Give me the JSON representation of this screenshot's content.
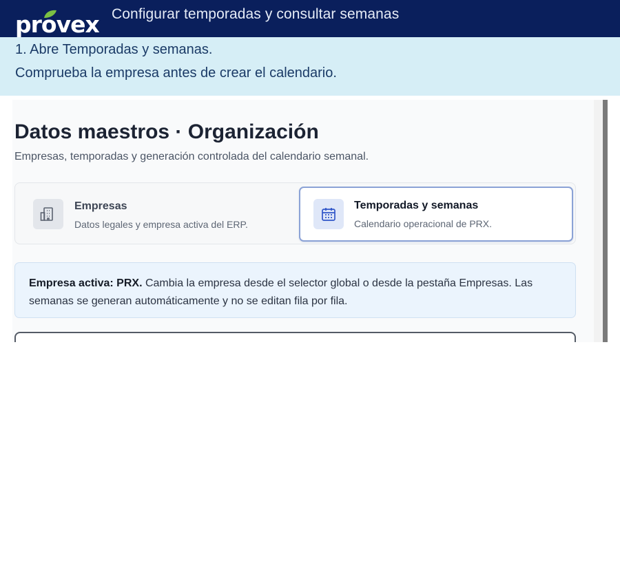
{
  "header": {
    "logo": "provex",
    "title": "Configurar temporadas y consultar semanas"
  },
  "instruction": {
    "line1": "1. Abre Temporadas y semanas.",
    "line2": "Comprueba la empresa antes de crear el calendario."
  },
  "screen": {
    "page_title": "Datos maestros · Organización",
    "page_subtitle": "Empresas, temporadas y generación controlada del calendario semanal.",
    "tabs": [
      {
        "label": "Empresas",
        "sub": "Datos legales y empresa activa del ERP.",
        "icon": "building-icon",
        "active": false
      },
      {
        "label": "Temporadas y semanas",
        "sub": "Calendario operacional de PRX.",
        "icon": "calendar-icon",
        "active": true
      }
    ],
    "notice": {
      "bold": "Empresa activa: PRX.",
      "text": " Cambia la empresa desde el selector global o desde la pestaña Empresas. Las semanas se generan automáticamente y no se editan fila por fila."
    }
  },
  "colors": {
    "header_bg": "#0a1f5c",
    "banner_bg": "#d6eef6",
    "leaf_green": "#7bc043",
    "active_tab_border": "#8ba2d6",
    "notice_bg": "#ebf4fd"
  }
}
